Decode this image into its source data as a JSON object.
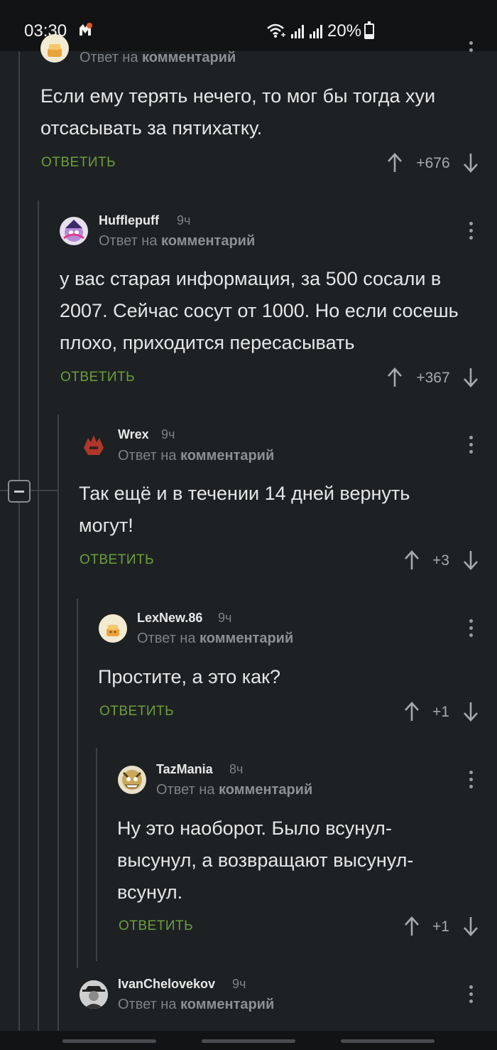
{
  "status": {
    "time": "03:30",
    "battery": "20%"
  },
  "labels": {
    "reply_prefix": "Ответ на",
    "reply_target": "комментарий",
    "answer": "ОТВЕТИТЬ"
  },
  "comments": [
    {
      "username": "",
      "time": "",
      "text": "Если ему терять нечего, то мог бы тогда хуи отсасывать за пятихатку.",
      "score": "+676"
    },
    {
      "username": "Hufflepuff",
      "time": "9ч",
      "text": "у вас старая информация, за 500 сосали в 2007. Сейчас сосут от 1000. Но если сосешь плохо, приходится пересасывать",
      "score": "+367"
    },
    {
      "username": "Wrex",
      "time": "9ч",
      "text": "Так ещё и в течении 14 дней вернуть могут!",
      "score": "+3"
    },
    {
      "username": "LexNew.86",
      "time": "9ч",
      "text": "Простите, а это как?",
      "score": "+1"
    },
    {
      "username": "TazMania",
      "time": "8ч",
      "text": "Ну это наоборот. Было всунул-высунул, а возвращают высунул-всунул.",
      "score": "+1"
    },
    {
      "username": "IvanChelovekov",
      "time": "9ч",
      "text": "",
      "score": ""
    }
  ],
  "colors": {
    "background": "#1e2123",
    "answer_link": "#6c9e3c",
    "thread_line": "#3f4245"
  },
  "icons": [
    "app-notification-icon",
    "wifi-icon",
    "signal-icon",
    "battery-icon",
    "collapse-thread-icon",
    "arrow-up-icon",
    "arrow-down-icon",
    "more-vertical-icon"
  ]
}
